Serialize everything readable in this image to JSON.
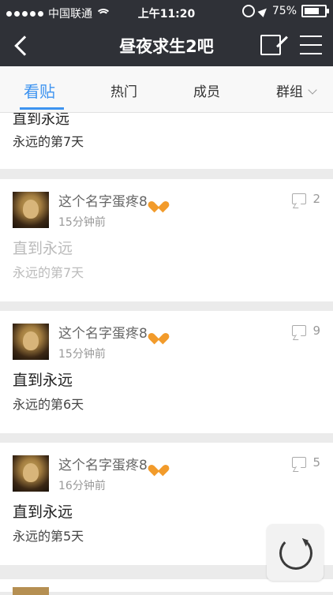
{
  "status_bar": {
    "carrier": "中国联通",
    "time": "上午11:20",
    "battery_percent": "75%",
    "battery_level": 0.75
  },
  "nav": {
    "title": "昼夜求生2吧"
  },
  "tabs": [
    {
      "label": "看贴",
      "active": true
    },
    {
      "label": "热门",
      "active": false
    },
    {
      "label": "成员",
      "active": false
    },
    {
      "label": "群组",
      "active": false
    }
  ],
  "top_card": {
    "title": "直到永远",
    "body": "永远的第7天"
  },
  "posts": [
    {
      "username": "这个名字蛋疼8",
      "time": "15分钟前",
      "comments": "2",
      "title": "直到永远",
      "body": "永远的第7天",
      "read": true
    },
    {
      "username": "这个名字蛋疼8",
      "time": "15分钟前",
      "comments": "9",
      "title": "直到永远",
      "body": "永远的第6天",
      "read": false
    },
    {
      "username": "这个名字蛋疼8",
      "time": "16分钟前",
      "comments": "5",
      "title": "直到永远",
      "body": "永远的第5天",
      "read": false
    }
  ],
  "colors": {
    "accent": "#3d93f0",
    "nav_bg": "#2f3137",
    "heart": "#f29b2b"
  },
  "icons": [
    "back-icon",
    "edit-icon",
    "menu-icon",
    "comment-icon",
    "refresh-icon"
  ]
}
